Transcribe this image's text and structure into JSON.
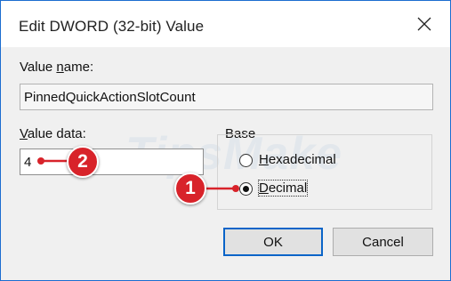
{
  "dialog": {
    "title": "Edit DWORD (32-bit) Value",
    "close_icon": "close-icon"
  },
  "value_name": {
    "label_pre": "Value ",
    "label_u": "n",
    "label_post": "ame:",
    "value": "PinnedQuickActionSlotCount"
  },
  "value_data": {
    "label_u": "V",
    "label_post": "alue data:",
    "value": "4"
  },
  "base": {
    "label": "Base",
    "options": [
      {
        "u": "H",
        "rest": "exadecimal",
        "selected": false
      },
      {
        "u": "D",
        "rest": "ecimal",
        "selected": true
      }
    ]
  },
  "buttons": {
    "ok": "OK",
    "cancel": "Cancel"
  },
  "watermark": "TipsMake",
  "annotations": {
    "badge1": "1",
    "badge2": "2",
    "color": "#d8232a"
  }
}
